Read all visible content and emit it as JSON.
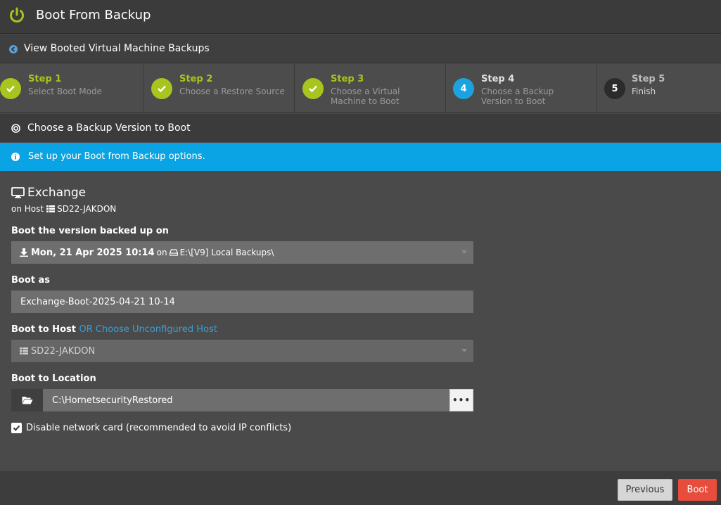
{
  "app": {
    "title": "Boot From Backup"
  },
  "nav": {
    "back_label": "View Booted Virtual Machine Backups"
  },
  "steps": [
    {
      "label": "Step 1",
      "desc": "Select Boot Mode",
      "state": "done",
      "number": "1"
    },
    {
      "label": "Step 2",
      "desc": "Choose a Restore Source",
      "state": "done",
      "number": "2"
    },
    {
      "label": "Step 3",
      "desc": "Choose a Virtual Machine to Boot",
      "state": "done",
      "number": "3"
    },
    {
      "label": "Step 4",
      "desc": "Choose a Backup Version to Boot",
      "state": "active",
      "number": "4"
    },
    {
      "label": "Step 5",
      "desc": "Finish",
      "state": "pending",
      "number": "5"
    }
  ],
  "section": {
    "title": "Choose a Backup Version to Boot"
  },
  "info": {
    "text": "Set up your Boot from Backup options."
  },
  "vm": {
    "name": "Exchange",
    "host_prefix": "on Host",
    "host_name": "SD22-JAKDON"
  },
  "fields": {
    "version_label": "Boot the version backed up on",
    "version_date": "Mon, 21 Apr 2025 10:14",
    "version_on": "on",
    "version_path": "E:\\[V9] Local Backups\\",
    "boot_as_label": "Boot as",
    "boot_as_value": "Exchange-Boot-2025-04-21 10-14",
    "host_label": "Boot to Host",
    "host_link": "OR Choose Unconfigured Host",
    "host_value": "SD22-JAKDON",
    "location_label": "Boot to Location",
    "location_value": "C:\\HornetsecurityRestored",
    "browse_label": "•••",
    "disable_nic_label": "Disable network card (recommended to avoid IP conflicts)",
    "disable_nic_checked": true
  },
  "buttons": {
    "previous": "Previous",
    "boot": "Boot"
  },
  "colors": {
    "accent_green": "#a8c41e",
    "accent_blue": "#0aa3e3",
    "danger": "#e74c3c",
    "link": "#3a9fd8"
  }
}
